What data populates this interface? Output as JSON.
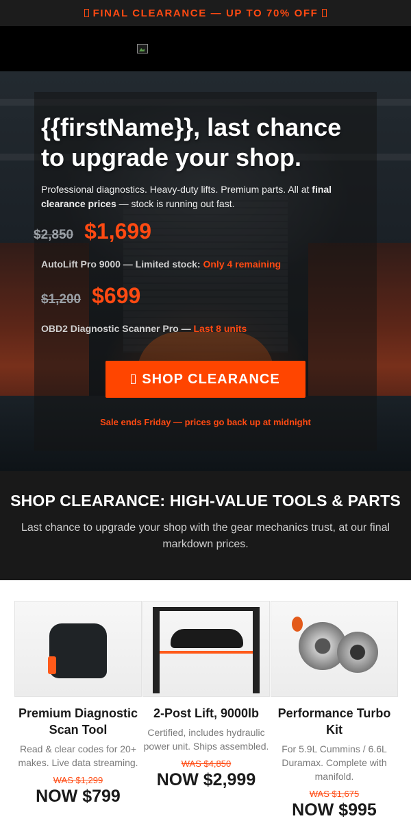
{
  "topbar": {
    "text": "FINAL CLEARANCE — UP TO 70% OFF",
    "icon": "tag-icon"
  },
  "hero": {
    "headline": "{{firstName}}, last chance to upgrade your shop.",
    "intro_a": "Professional diagnostics. Heavy-duty lifts. Premium parts. All at ",
    "intro_bold": "final clearance prices",
    "intro_b": " — stock is running out fast.",
    "deals": [
      {
        "was": "$2,850",
        "now": "$1,699",
        "label": "AutoLift Pro 9000 — Limited stock: ",
        "highlight": "Only 4 remaining"
      },
      {
        "was": "$1,200",
        "now": "$699",
        "label": "OBD2 Diagnostic Scanner Pro — ",
        "highlight": "Last 8 units"
      }
    ],
    "cta": "SHOP CLEARANCE",
    "cta_icon": "cart-icon",
    "sale_ends": "Sale ends Friday — prices go back up at midnight"
  },
  "section": {
    "title": "SHOP CLEARANCE: HIGH-VALUE TOOLS & PARTS",
    "subtitle": "Last chance to upgrade your shop with the gear mechanics trust, at our final markdown prices."
  },
  "products": [
    {
      "name": "Premium Diagnostic Scan Tool",
      "desc": "Read & clear codes for 20+ makes. Live data streaming.",
      "was": "WAS $1,299",
      "now": "NOW $799"
    },
    {
      "name": "2-Post Lift, 9000lb",
      "desc": "Certified, includes hydraulic power unit. Ships assembled.",
      "was": "WAS $4,850",
      "now": "NOW $2,999"
    },
    {
      "name": "Performance Turbo Kit",
      "desc": "For 5.9L Cummins / 6.6L Duramax. Complete with manifold.",
      "was": "WAS $1,675",
      "now": "NOW $995"
    }
  ],
  "colors": {
    "accent": "#ff4500",
    "dark": "#191919"
  }
}
